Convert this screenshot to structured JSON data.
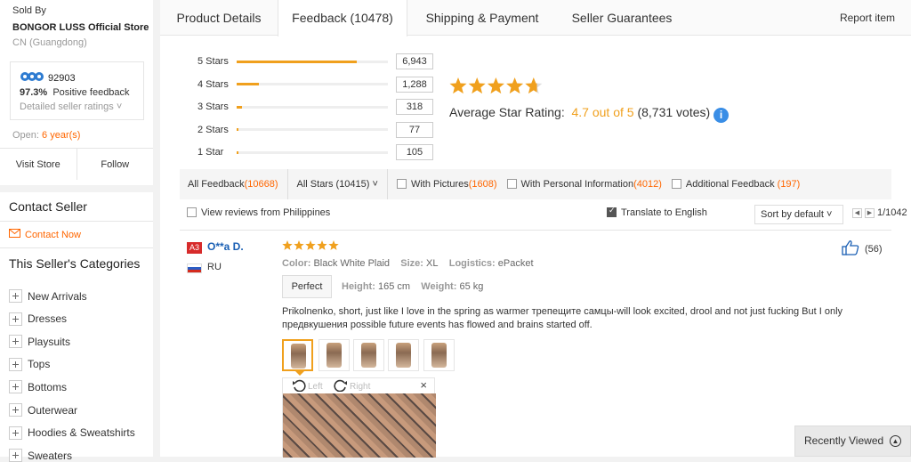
{
  "seller": {
    "sold_by": "Sold By",
    "store_name": "BONGOR LUSS Official Store",
    "location": "CN (Guangdong)",
    "points": "92903",
    "positive_pct": "97.3%",
    "positive_label": "Positive feedback",
    "detailed_ratings": "Detailed seller ratings",
    "open_label": "Open:",
    "open_years": "6 year(s)",
    "visit_store": "Visit Store",
    "follow": "Follow"
  },
  "contact": {
    "title": "Contact Seller",
    "contact_now": "Contact Now",
    "categories_title": "This Seller's Categories",
    "categories": [
      "New Arrivals",
      "Dresses",
      "Playsuits",
      "Tops",
      "Bottoms",
      "Outerwear",
      "Hoodies & Sweatshirts",
      "Sweaters"
    ]
  },
  "tabs": [
    "Product Details",
    "Feedback (10478)",
    "Shipping & Payment",
    "Seller Guarantees"
  ],
  "report_item": "Report item",
  "rating_breakdown": [
    {
      "label": "5 Stars",
      "count": "6,943",
      "fraction": 0.795
    },
    {
      "label": "4 Stars",
      "count": "1,288",
      "fraction": 0.148
    },
    {
      "label": "3 Stars",
      "count": "318",
      "fraction": 0.036
    },
    {
      "label": "2 Stars",
      "count": "77",
      "fraction": 0.009
    },
    {
      "label": "1 Star",
      "count": "105",
      "fraction": 0.012
    }
  ],
  "average": {
    "label": "Average Star Rating:",
    "value": "4.7 out of 5",
    "votes": "(8,731 votes)",
    "stars": 4.7
  },
  "filters": {
    "all_feedback": "All Feedback",
    "all_feedback_count": "(10668)",
    "all_stars": "All Stars (10415)",
    "with_pictures": "With Pictures",
    "with_pictures_count": "(1608)",
    "with_personal": "With Personal Information",
    "with_personal_count": "(4012)",
    "additional": "Additional Feedback",
    "additional_count": "(197)",
    "view_reviews_from": "View reviews from Philippines",
    "translate": "Translate to English",
    "sort": "Sort by default",
    "page": "1/1042"
  },
  "review": {
    "badge": "A3",
    "user": "O**a D.",
    "country": "RU",
    "stars": 5,
    "color_label": "Color:",
    "color": "Black White Plaid",
    "size_label": "Size:",
    "size": "XL",
    "logistics_label": "Logistics:",
    "logistics": "ePacket",
    "fit": "Perfect",
    "height_label": "Height:",
    "height": "165 cm",
    "weight_label": "Weight:",
    "weight": "65 kg",
    "text": "Prikolnenko, short, just like I love in the spring as warmer трепещите самцы-will look excited, drool and not just fucking But I only предвкушения possible future events has flowed and brains started off.",
    "likes": "(56)",
    "rotate_left": "Left",
    "rotate_right": "Right",
    "close": "×"
  },
  "recently_viewed": "Recently Viewed",
  "colors": {
    "accent": "#f0a01d",
    "orange": "#ff6600",
    "link": "#1a5fb4",
    "info": "#3a8ee6"
  }
}
